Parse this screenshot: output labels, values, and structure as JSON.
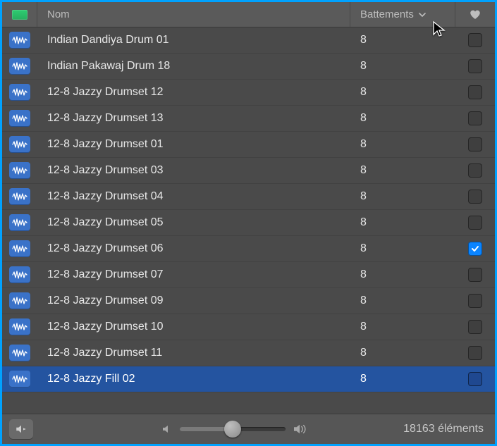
{
  "header": {
    "name_label": "Nom",
    "beats_label": "Battements",
    "sort_dir": "desc"
  },
  "rows": [
    {
      "name": "Indian Dandiya Drum 01",
      "beats": "8",
      "fav": false,
      "selected": false
    },
    {
      "name": "Indian Pakawaj Drum 18",
      "beats": "8",
      "fav": false,
      "selected": false
    },
    {
      "name": "12-8 Jazzy Drumset 12",
      "beats": "8",
      "fav": false,
      "selected": false
    },
    {
      "name": "12-8 Jazzy Drumset 13",
      "beats": "8",
      "fav": false,
      "selected": false
    },
    {
      "name": "12-8 Jazzy Drumset 01",
      "beats": "8",
      "fav": false,
      "selected": false
    },
    {
      "name": "12-8 Jazzy Drumset 03",
      "beats": "8",
      "fav": false,
      "selected": false
    },
    {
      "name": "12-8 Jazzy Drumset 04",
      "beats": "8",
      "fav": false,
      "selected": false
    },
    {
      "name": "12-8 Jazzy Drumset 05",
      "beats": "8",
      "fav": false,
      "selected": false
    },
    {
      "name": "12-8 Jazzy Drumset 06",
      "beats": "8",
      "fav": true,
      "selected": false
    },
    {
      "name": "12-8 Jazzy Drumset 07",
      "beats": "8",
      "fav": false,
      "selected": false
    },
    {
      "name": "12-8 Jazzy Drumset 09",
      "beats": "8",
      "fav": false,
      "selected": false
    },
    {
      "name": "12-8 Jazzy Drumset 10",
      "beats": "8",
      "fav": false,
      "selected": false
    },
    {
      "name": "12-8 Jazzy Drumset 11",
      "beats": "8",
      "fav": false,
      "selected": false
    },
    {
      "name": "12-8 Jazzy Fill 02",
      "beats": "8",
      "fav": false,
      "selected": true
    }
  ],
  "footer": {
    "item_count": "18163 éléments",
    "volume_pct": 50
  }
}
